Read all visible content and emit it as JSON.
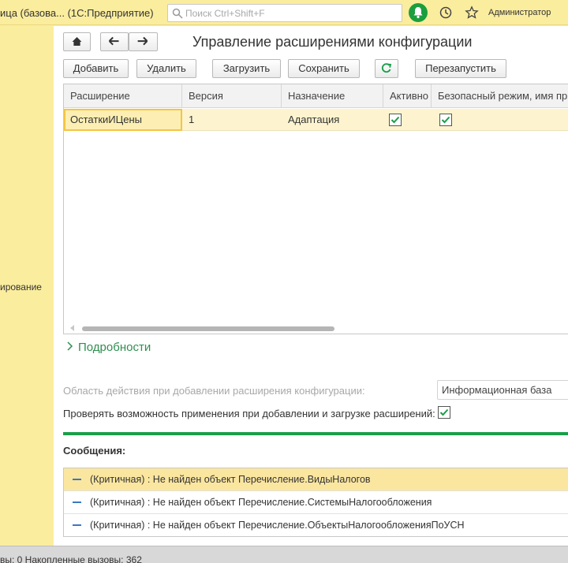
{
  "titlebar": {
    "app_title": "ица (базова...  (1С:Предприятие)",
    "search_placeholder": "Поиск Ctrl+Shift+F",
    "user": "Администратор"
  },
  "leftpanel": {
    "partial_label": "ирование"
  },
  "page": {
    "title": "Управление расширениями конфигурации"
  },
  "toolbar": {
    "add": "Добавить",
    "delete": "Удалить",
    "load": "Загрузить",
    "save": "Сохранить",
    "restart": "Перезапустить"
  },
  "table": {
    "columns": [
      "Расширение",
      "Версия",
      "Назначение",
      "Активно",
      "Безопасный режим, имя пр"
    ],
    "rows": [
      {
        "extension": "ОстаткиИЦены",
        "version": "1",
        "purpose": "Адаптация",
        "active": true,
        "safe_mode": true
      }
    ]
  },
  "details": {
    "label": "Подробности"
  },
  "settings": {
    "scope_label": "Область действия при добавлении расширения конфигурации:",
    "scope_value": "Информационная база",
    "verify_label": "Проверять возможность применения при добавлении и загрузке расширений:",
    "verify_checked": true
  },
  "messages": {
    "title": "Сообщения:",
    "items": [
      "(Критичная) : Не найден объект Перечисление.ВидыНалогов",
      "(Критичная) : Не найден объект Перечисление.СистемыНалогообложения",
      "(Критичная) : Не найден объект Перечисление.ОбъектыНалогообложенияПоУСН"
    ]
  },
  "statusbar": {
    "text": "вы: 0   Накопленные вызовы: 362"
  },
  "colors": {
    "panel_bg": "#fbed9e",
    "accent_green": "#1a9e4a",
    "selected_row": "#fdf4cf",
    "selected_cell_border": "#f4c542",
    "message_dash": "#3a78c2"
  },
  "icons": [
    "search-icon",
    "bell-icon",
    "history-icon",
    "star-icon",
    "home-icon",
    "arrow-left-icon",
    "arrow-right-icon",
    "refresh-icon",
    "checkbox-checked-icon",
    "chevron-right-icon"
  ]
}
